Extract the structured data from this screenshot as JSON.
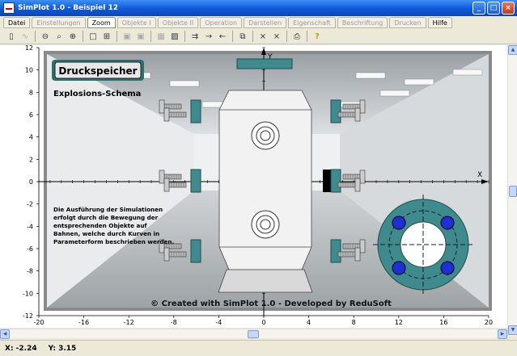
{
  "window": {
    "title": "SimPlot 1.0 - Beispiel 12"
  },
  "menu": [
    {
      "label": "Datei",
      "state": "enabled"
    },
    {
      "label": "Einstellungen",
      "state": "disabled"
    },
    {
      "label": "Zoom",
      "state": "active"
    },
    {
      "label": "Objekte I",
      "state": "disabled"
    },
    {
      "label": "Objekte II",
      "state": "disabled"
    },
    {
      "label": "Operation",
      "state": "disabled"
    },
    {
      "label": "Darstellen",
      "state": "disabled"
    },
    {
      "label": "Eigenschaft",
      "state": "disabled"
    },
    {
      "label": "Beschriftung",
      "state": "disabled"
    },
    {
      "label": "Drucken",
      "state": "disabled"
    },
    {
      "label": "Hilfe",
      "state": "enabled"
    }
  ],
  "plot": {
    "title": "Druckspeicher",
    "subtitle": "Explosions-Schema",
    "description": [
      "Die Ausführung der Simulationen",
      "erfolgt durch die Bewegung der",
      "entsprechenden Objekte auf",
      "Bahnen, welche durch Kurven in",
      "Parameterform beschrieben werden."
    ],
    "footer": "© Created with SimPlot 1.0 - Developed by ReduSoft",
    "xaxis_label": "X",
    "yaxis_label": "Y",
    "xlim": [
      -20,
      20
    ],
    "ylim": [
      -12,
      12
    ],
    "xticks": [
      -20,
      -16,
      -12,
      -8,
      -4,
      0,
      4,
      8,
      12,
      16,
      20
    ],
    "yticks": [
      -12,
      -10,
      -8,
      -6,
      -4,
      -2,
      0,
      2,
      4,
      6,
      8,
      10,
      12
    ],
    "colors": {
      "teal": "#3f8a8c",
      "bolt_circle": "#1f2fd6",
      "vessel": "#f2f2f2",
      "frame": "#7a7a7a",
      "badge_bg": "#2e6e6e"
    }
  },
  "status": {
    "x": "X: -2.24",
    "y": "Y: 3.15"
  }
}
